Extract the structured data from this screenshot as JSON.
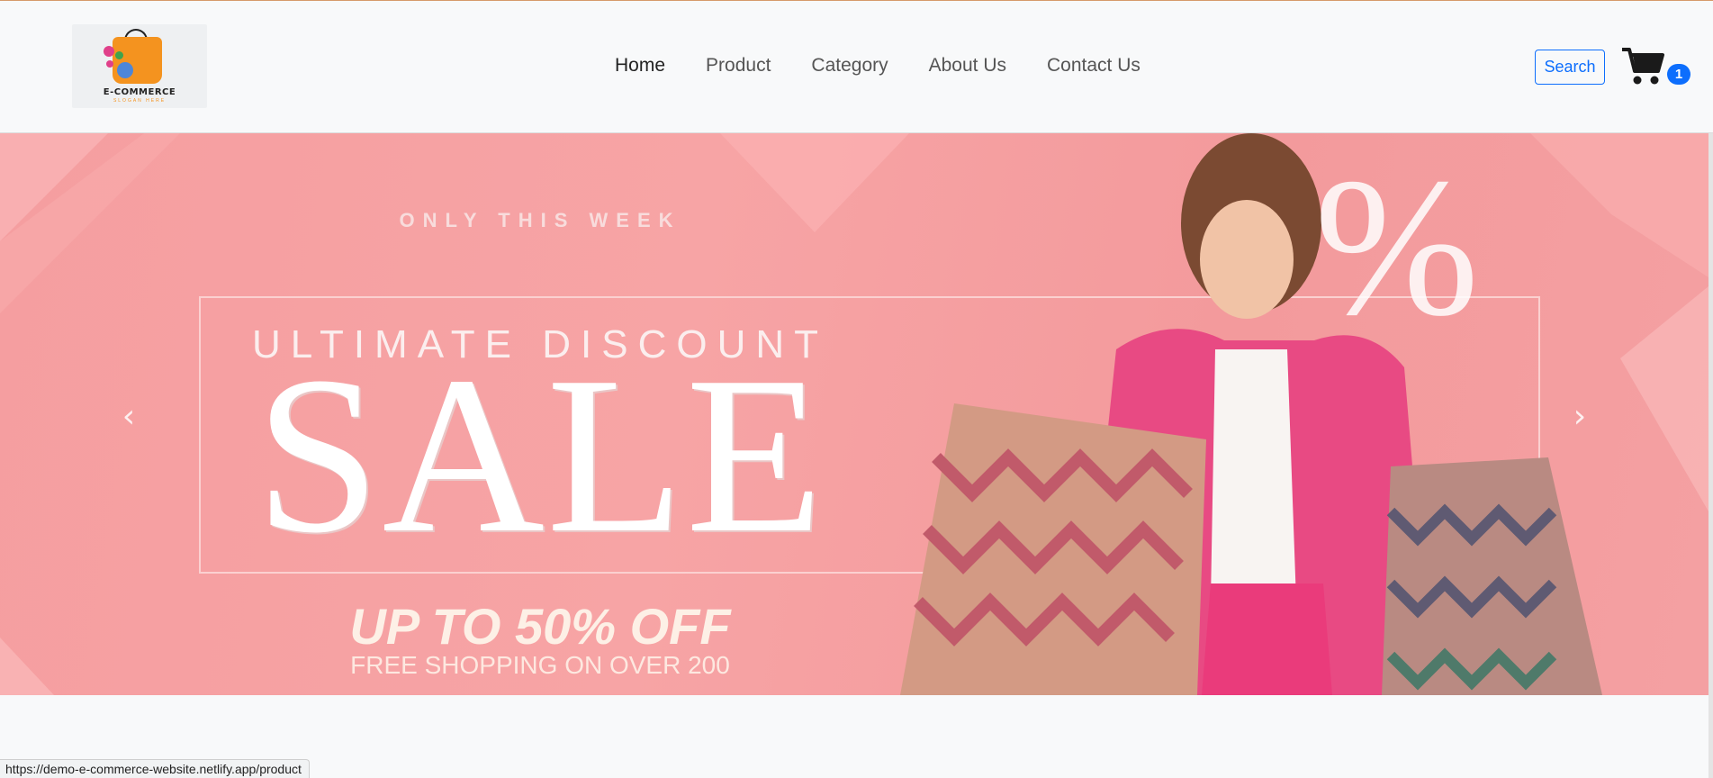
{
  "brand": {
    "name": "E-COMMERCE",
    "slogan": "SLOGAN HERE",
    "accent": "#f4931f"
  },
  "nav": {
    "items": [
      {
        "label": "Home",
        "active": true
      },
      {
        "label": "Product",
        "active": false
      },
      {
        "label": "Category",
        "active": false
      },
      {
        "label": "About Us",
        "active": false
      },
      {
        "label": "Contact Us",
        "active": false
      }
    ]
  },
  "header": {
    "search_label": "Search",
    "cart_icon": "cart-icon",
    "cart_count": "1",
    "primary_color": "#0d6efd"
  },
  "banner": {
    "kicker": "ONLY THIS WEEK",
    "headline": "ULTIMATE DISCOUNT",
    "big": "SALE",
    "offer": "UP TO 50% OFF",
    "subline": "FREE SHOPPING ON OVER 200",
    "prev_icon": "chevron-left-icon",
    "next_icon": "chevron-right-icon"
  },
  "status_bar": {
    "url": "https://demo-e-commerce-website.netlify.app/product"
  }
}
